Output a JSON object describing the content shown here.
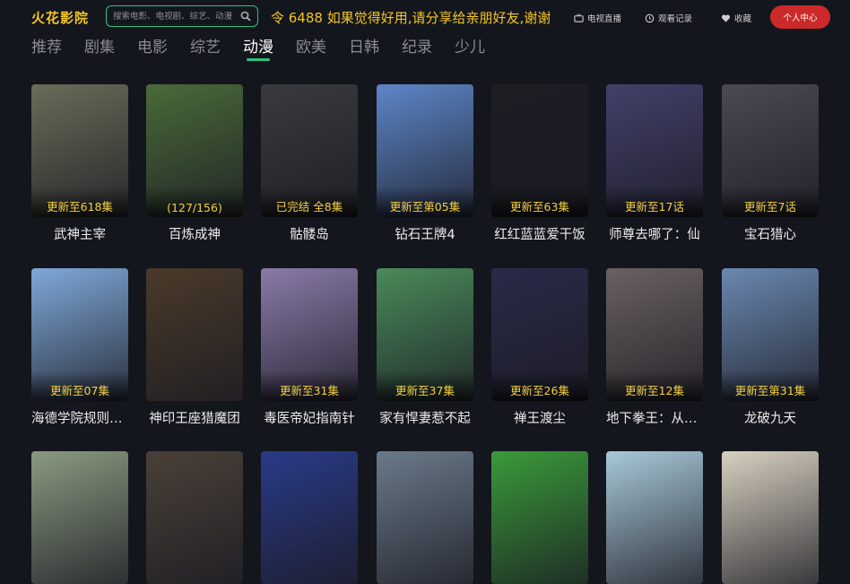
{
  "app": {
    "logo": "火花影院"
  },
  "search": {
    "placeholder": "搜索电影、电视剧、综艺、动漫"
  },
  "notice": "令 6488 如果觉得好用,请分享给亲朋好友,谢谢",
  "header_buttons": {
    "tv_live": "电视直播",
    "history": "观看记录",
    "favorites": "收藏",
    "user_center": "个人中心"
  },
  "tabs": [
    "推荐",
    "剧集",
    "电影",
    "综艺",
    "动漫",
    "欧美",
    "日韩",
    "纪录",
    "少儿"
  ],
  "active_tab": "动漫",
  "rows": [
    [
      {
        "title": "武神主宰",
        "badge": "更新至618集",
        "color": "#6b6b58"
      },
      {
        "title": "百炼成神",
        "badge": "(127/156)",
        "color": "#4a6a3a"
      },
      {
        "title": "骷髅岛",
        "badge": "已完结 全8集",
        "color": "#3a3a3e"
      },
      {
        "title": "钻石王牌4",
        "badge": "更新至第05集",
        "color": "#5d86c8"
      },
      {
        "title": "红红蓝蓝爱干饭",
        "badge": "更新至63集",
        "color": "#1c1e24"
      },
      {
        "title": "师尊去哪了：仙",
        "badge": "更新至17话",
        "color": "#42406a"
      },
      {
        "title": "宝石猎心",
        "badge": "更新至7话",
        "color": "#4a4a52"
      }
    ],
    [
      {
        "title": "海德学院规则怪谈",
        "badge": "更新至07集",
        "color": "#7fa8d8"
      },
      {
        "title": "神印王座猎魔团",
        "badge": "",
        "color": "#4a3a2a"
      },
      {
        "title": "毒医帝妃指南针",
        "badge": "更新至31集",
        "color": "#8a7aa8"
      },
      {
        "title": "家有悍妻惹不起",
        "badge": "更新至37集",
        "color": "#4a8a5a"
      },
      {
        "title": "禅王渡尘",
        "badge": "更新至26集",
        "color": "#2a2a48"
      },
      {
        "title": "地下拳王：从零开始",
        "badge": "更新至12集",
        "color": "#6a6060"
      },
      {
        "title": "龙破九天",
        "badge": "更新至第31集",
        "color": "#6a88b0"
      }
    ],
    [
      {
        "title": "",
        "badge": "",
        "color": "#8a9a80"
      },
      {
        "title": "",
        "badge": "",
        "color": "#4a4038"
      },
      {
        "title": "",
        "badge": "",
        "color": "#2a3a88"
      },
      {
        "title": "",
        "badge": "",
        "color": "#6a7a8a"
      },
      {
        "title": "",
        "badge": "",
        "color": "#3a9a3a"
      },
      {
        "title": "",
        "badge": "",
        "color": "#a8c8d8"
      },
      {
        "title": "",
        "badge": "",
        "color": "#d8d0c0"
      }
    ]
  ]
}
